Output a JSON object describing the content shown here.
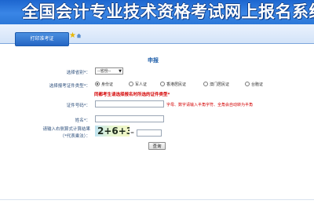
{
  "header": {
    "title": "全国会计专业技术资格考试网上报名系统",
    "tab_label": "打印准考证"
  },
  "form": {
    "heading": "申报",
    "province_label": "选择省别*：",
    "province_value": "--省份--",
    "id_type_label": "选择报考证件类型*：",
    "id_types": [
      "身份证",
      "军人证",
      "香港居民证",
      "澳门居民证",
      "台胞证"
    ],
    "id_type_selected": "身份证",
    "warning": "同都考生请选择报名时所选的证件类型*",
    "id_number_label": "证件号码*：",
    "id_number_hint": "字母、数字请输入半角字符、全角会自动转为半角",
    "name_label": "姓名*：",
    "captcha_label_line1": "请输入右侧算式计算结果",
    "captcha_label_line2": "（*代表乘法）：",
    "captcha_expression": "2+6+3",
    "captcha_equals": "=",
    "submit_label": "查询"
  },
  "colors": {
    "banner": "#2b77d8",
    "warning": "#d40000",
    "label": "#2d4f7c"
  }
}
